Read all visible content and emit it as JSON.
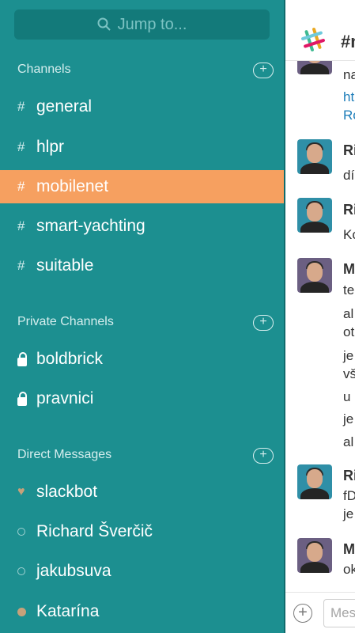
{
  "sidebar": {
    "search_placeholder": "Jump to...",
    "sections": {
      "channels": "Channels",
      "private": "Private Channels",
      "direct": "Direct Messages"
    },
    "channels": [
      "general",
      "hlpr",
      "mobilenet",
      "smart-yachting",
      "suitable"
    ],
    "active_channel": "mobilenet",
    "private_channels": [
      "boldbrick",
      "pravnici"
    ],
    "direct_messages": [
      {
        "name": "slackbot",
        "status": "heart"
      },
      {
        "name": "Richard Šverčič",
        "status": "away"
      },
      {
        "name": "jakubsuva",
        "status": "away"
      },
      {
        "name": "Katarína",
        "status": "active"
      }
    ],
    "hash_symbol": "#"
  },
  "chat": {
    "title": "#m",
    "messages": [
      {
        "name": "",
        "lines": [
          "na",
          "ht",
          "Ro"
        ]
      },
      {
        "name": "Ri",
        "lines": [
          "dí"
        ]
      },
      {
        "name": "Ri",
        "lines": [
          "Ko"
        ]
      },
      {
        "name": "M",
        "lines": [
          "te",
          "al",
          "ot",
          "je",
          "vš",
          "u",
          "je",
          "al"
        ]
      },
      {
        "name": "Ri",
        "lines": [
          "fD",
          "je"
        ]
      },
      {
        "name": "M",
        "lines": [
          "ok"
        ]
      }
    ],
    "composer_placeholder": "Mes"
  },
  "colors": {
    "sidebar_bg": "#1c8f90",
    "active_bg": "#f6a060",
    "link": "#1d7db9"
  }
}
